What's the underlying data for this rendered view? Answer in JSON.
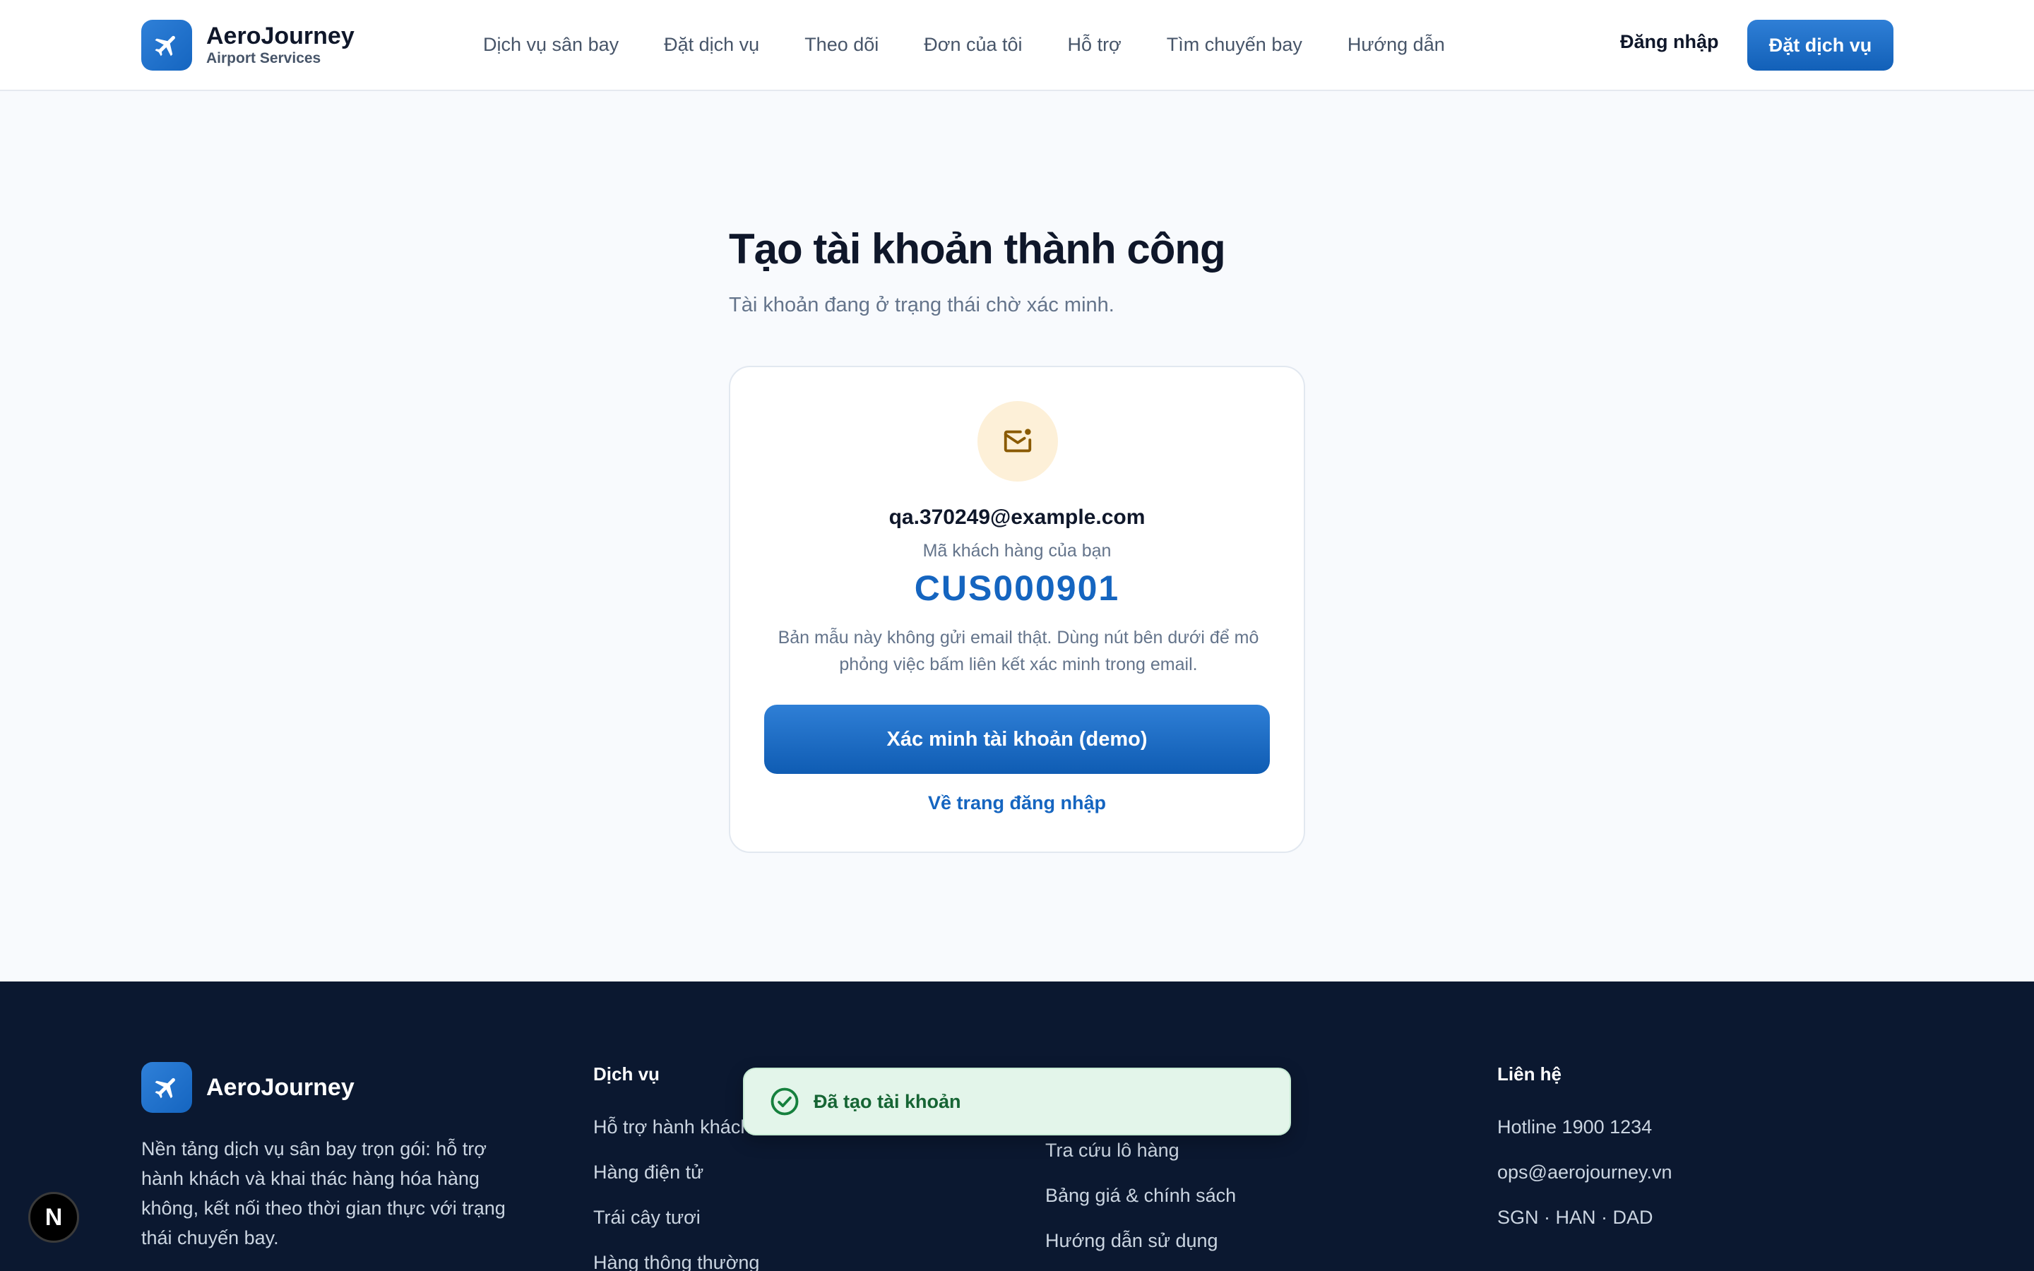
{
  "header": {
    "brand_name": "AeroJourney",
    "brand_sub": "Airport Services",
    "nav": [
      "Dịch vụ sân bay",
      "Đặt dịch vụ",
      "Theo dõi",
      "Đơn của tôi",
      "Hỗ trợ",
      "Tìm chuyến bay",
      "Hướng dẫn"
    ],
    "login_label": "Đăng nhập",
    "book_label": "Đặt dịch vụ"
  },
  "main": {
    "title": "Tạo tài khoản thành công",
    "subtitle": "Tài khoản đang ở trạng thái chờ xác minh.",
    "card": {
      "icon": "mail-icon",
      "email": "qa.370249@example.com",
      "code_label": "Mã khách hàng của bạn",
      "code": "CUS000901",
      "note": "Bản mẫu này không gửi email thật. Dùng nút bên dưới để mô phỏng việc bấm liên kết xác minh trong email.",
      "verify_label": "Xác minh tài khoản (demo)",
      "back_label": "Về trang đăng nhập"
    }
  },
  "footer": {
    "brand_name": "AeroJourney",
    "description": "Nền tảng dịch vụ sân bay trọn gói: hỗ trợ hành khách và khai thác hàng hóa hàng không, kết nối theo thời gian thực với trạng thái chuyến bay.",
    "columns": [
      {
        "title": "Dịch vụ",
        "links": [
          "Hỗ trợ hành khách",
          "Hàng điện tử",
          "Trái cây tươi",
          "Hàng thông thường"
        ]
      },
      {
        "title": "",
        "links": [
          "",
          "Tra cứu lô hàng",
          "Bảng giá & chính sách",
          "Hướng dẫn sử dụng"
        ]
      },
      {
        "title": "Liên hệ",
        "links": [
          "Hotline 1900 1234",
          "ops@aerojourney.vn",
          "SGN · HAN · DAD"
        ]
      }
    ]
  },
  "toast": {
    "message": "Đã tạo tài khoản"
  },
  "dev_badge": {
    "label": "N"
  },
  "colors": {
    "primary": "#1565c0",
    "footer_bg": "#0b1830",
    "toast_bg": "#e3f5ea",
    "toast_text": "#166534",
    "mail_badge_bg": "#fdf0d8"
  }
}
